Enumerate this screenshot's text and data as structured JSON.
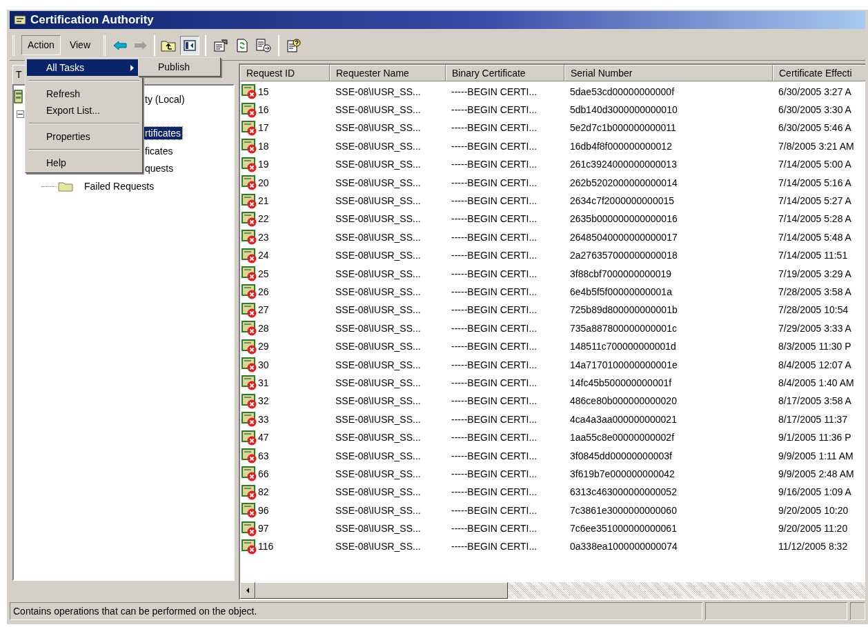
{
  "window": {
    "title": "Certification Authority"
  },
  "menubar": [
    {
      "label": "Action",
      "selected": true
    },
    {
      "label": "View",
      "selected": false
    }
  ],
  "left_pane": {
    "tab": "T"
  },
  "tree": [
    {
      "label": "ty (Local)",
      "expanded": true,
      "selected": false,
      "children": [
        {
          "label": "rtificates",
          "selected": true
        },
        {
          "label": "ficates",
          "selected": false
        },
        {
          "label": "quests",
          "selected": false
        },
        {
          "label": "Failed Requests",
          "selected": false
        }
      ]
    }
  ],
  "context_menu": {
    "groups": [
      [
        {
          "label": "All Tasks",
          "selected": true,
          "kind": "submenu"
        }
      ],
      [
        {
          "label": "Refresh",
          "selected": false,
          "kind": "item"
        },
        {
          "label": "Export List...",
          "selected": false,
          "kind": "item"
        }
      ],
      [
        {
          "label": "Properties",
          "selected": false,
          "kind": "item"
        }
      ],
      [
        {
          "label": "Help",
          "selected": false,
          "kind": "item"
        }
      ]
    ],
    "submenu": [
      {
        "label": "Publish",
        "selected": false
      }
    ]
  },
  "table": {
    "columns": [
      "Request ID",
      "Requester Name",
      "Binary Certificate",
      "Serial Number",
      "Certificate Effecti"
    ],
    "rows": [
      [
        "15",
        "SSE-08\\IUSR_SS...",
        "-----BEGIN CERTI...",
        "5dae53cd00000000000f",
        "6/30/2005 3:27 A"
      ],
      [
        "16",
        "SSE-08\\IUSR_SS...",
        "-----BEGIN CERTI...",
        "5db140d3000000000010",
        "6/30/2005 3:30 A"
      ],
      [
        "17",
        "SSE-08\\IUSR_SS...",
        "-----BEGIN CERTI...",
        "5e2d7c1b000000000011",
        "6/30/2005 5:46 A"
      ],
      [
        "18",
        "SSE-08\\IUSR_SS...",
        "-----BEGIN CERTI...",
        "16db4f8f000000000012",
        "7/8/2005 3:21 AM"
      ],
      [
        "19",
        "SSE-08\\IUSR_SS...",
        "-----BEGIN CERTI...",
        "261c3924000000000013",
        "7/14/2005 5:00 A"
      ],
      [
        "20",
        "SSE-08\\IUSR_SS...",
        "-----BEGIN CERTI...",
        "262b5202000000000014",
        "7/14/2005 5:16 A"
      ],
      [
        "21",
        "SSE-08\\IUSR_SS...",
        "-----BEGIN CERTI...",
        "2634c7f2000000000015",
        "7/14/2005 5:27 A"
      ],
      [
        "22",
        "SSE-08\\IUSR_SS...",
        "-----BEGIN CERTI...",
        "2635b000000000000016",
        "7/14/2005 5:28 A"
      ],
      [
        "23",
        "SSE-08\\IUSR_SS...",
        "-----BEGIN CERTI...",
        "26485040000000000017",
        "7/14/2005 5:48 A"
      ],
      [
        "24",
        "SSE-08\\IUSR_SS...",
        "-----BEGIN CERTI...",
        "2a276357000000000018",
        "7/14/2005 11:51"
      ],
      [
        "25",
        "SSE-08\\IUSR_SS...",
        "-----BEGIN CERTI...",
        "3f88cbf7000000000019",
        "7/19/2005 3:29 A"
      ],
      [
        "26",
        "SSE-08\\IUSR_SS...",
        "-----BEGIN CERTI...",
        "6e4b5f5f00000000001a",
        "7/28/2005 3:58 A"
      ],
      [
        "27",
        "SSE-08\\IUSR_SS...",
        "-----BEGIN CERTI...",
        "725b89d800000000001b",
        "7/28/2005 10:54"
      ],
      [
        "28",
        "SSE-08\\IUSR_SS...",
        "-----BEGIN CERTI...",
        "735a887800000000001c",
        "7/29/2005 3:33 A"
      ],
      [
        "29",
        "SSE-08\\IUSR_SS...",
        "-----BEGIN CERTI...",
        "148511c700000000001d",
        "8/3/2005 11:30 P"
      ],
      [
        "30",
        "SSE-08\\IUSR_SS...",
        "-----BEGIN CERTI...",
        "14a7170100000000001e",
        "8/4/2005 12:07 A"
      ],
      [
        "31",
        "SSE-08\\IUSR_SS...",
        "-----BEGIN CERTI...",
        "14fc45b500000000001f",
        "8/4/2005 1:40 AM"
      ],
      [
        "32",
        "SSE-08\\IUSR_SS...",
        "-----BEGIN CERTI...",
        "486ce80b000000000020",
        "8/17/2005 3:58 A"
      ],
      [
        "33",
        "SSE-08\\IUSR_SS...",
        "-----BEGIN CERTI...",
        "4ca4a3aa000000000021",
        "8/17/2005 11:37"
      ],
      [
        "47",
        "SSE-08\\IUSR_SS...",
        "-----BEGIN CERTI...",
        "1aa55c8e00000000002f",
        "9/1/2005 11:36 P"
      ],
      [
        "63",
        "SSE-08\\IUSR_SS...",
        "-----BEGIN CERTI...",
        "3f0845dd00000000003f",
        "9/9/2005 1:11 AM"
      ],
      [
        "66",
        "SSE-08\\IUSR_SS...",
        "-----BEGIN CERTI...",
        "3f619b7e000000000042",
        "9/9/2005 2:48 AM"
      ],
      [
        "82",
        "SSE-08\\IUSR_SS...",
        "-----BEGIN CERTI...",
        "6313c463000000000052",
        "9/16/2005 1:09 A"
      ],
      [
        "96",
        "SSE-08\\IUSR_SS...",
        "-----BEGIN CERTI...",
        "7c3861e3000000000060",
        "9/20/2005 10:20"
      ],
      [
        "97",
        "SSE-08\\IUSR_SS...",
        "-----BEGIN CERTI...",
        "7c6ee351000000000061",
        "9/20/2005 11:20"
      ],
      [
        "116",
        "SSE-08\\IUSR_SS...",
        "-----BEGIN CERTI...",
        "0a338ea1000000000074",
        "11/12/2005 8:32"
      ]
    ]
  },
  "status_bar": {
    "text": "Contains operations that can be performed on the object."
  }
}
